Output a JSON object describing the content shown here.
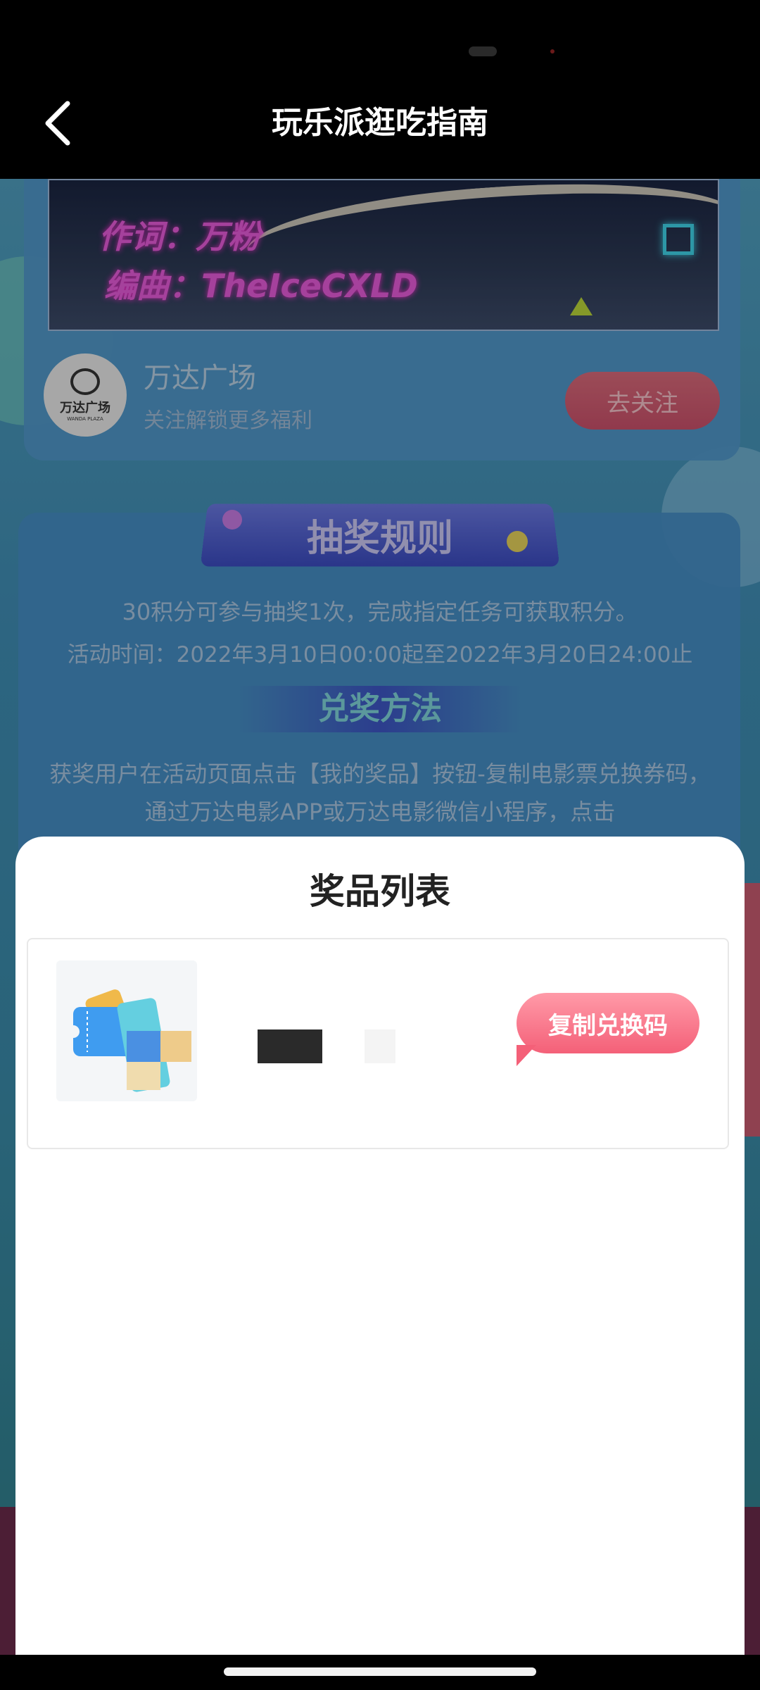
{
  "nav": {
    "title": "玩乐派逛吃指南"
  },
  "video": {
    "lyric1": "作词：万粉",
    "lyric2": "编曲：TheIceCXLD"
  },
  "store": {
    "logo_text": "万达广场",
    "logo_sub": "WANDA PLAZA",
    "name": "万达广场",
    "subtitle": "关注解锁更多福利",
    "follow_label": "去关注"
  },
  "rules": {
    "banner": "抽奖规则",
    "line1": "30积分可参与抽奖1次，完成指定任务可获取积分。",
    "line2": "活动时间：2022年3月10日00:00起至2022年3月20日24:00止",
    "redeem_title": "兑奖方法",
    "redeem_text": "获奖用户在活动页面点击【我的奖品】按钮-复制电影票兑换券码，通过万达电影APP或万达电影微信小程序，点击"
  },
  "sheet": {
    "title": "奖品列表",
    "prizes": [
      {
        "copy_label": "复制兑换码"
      }
    ]
  },
  "colors": {
    "accent_pink": "#f46078",
    "page_blue": "#4f9dbd",
    "sheet_bg": "#ffffff"
  }
}
